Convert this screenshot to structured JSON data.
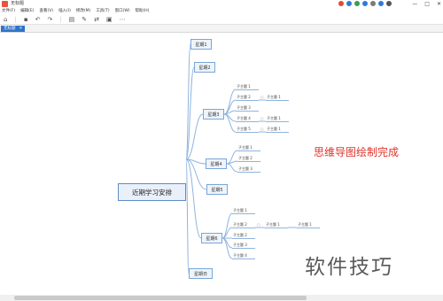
{
  "window": {
    "title": "无标题"
  },
  "tray_icons": [
    "#e34a2f",
    "#2f7cd6",
    "#3aa04d",
    "#2f7cd6",
    "#7a7a7a",
    "#2f7cd6",
    "#555555"
  ],
  "window_controls": [
    "—",
    "□",
    "✕"
  ],
  "menu": [
    "文件(F)",
    "编辑(E)",
    "查看(V)",
    "插入(I)",
    "修改(M)",
    "工具(T)",
    "窗口(W)",
    "帮助(H)"
  ],
  "toolbar_icons": [
    "home-icon",
    "save-icon",
    "undo-icon",
    "redo-icon",
    "folder-icon",
    "style-icon",
    "layout-icon",
    "image-icon",
    "more-icon"
  ],
  "toolbar_glyphs": [
    "⌂",
    "▪",
    "↶",
    "↷",
    "▤",
    "✎",
    "⇄",
    "▣",
    "⋯"
  ],
  "tab": {
    "label": "无标题",
    "close": "✕"
  },
  "mindmap": {
    "root": "近期学习安排",
    "topics": [
      {
        "label": "星期1"
      },
      {
        "label": "星期2"
      },
      {
        "label": "星期3",
        "subs": [
          {
            "label": "子主题 1"
          },
          {
            "label": "子主题 2",
            "child": "子主题 1"
          },
          {
            "label": "子主题 3"
          },
          {
            "label": "子主题 4",
            "child": "子主题 1"
          },
          {
            "label": "子主题 5",
            "child": "子主题 1"
          }
        ]
      },
      {
        "label": "星期4",
        "subs": [
          {
            "label": "子主题 1"
          },
          {
            "label": "子主题 2"
          },
          {
            "label": "子主题 3"
          }
        ]
      },
      {
        "label": "星期5"
      },
      {
        "label": "星期6",
        "subs": [
          {
            "label": "子主题 1"
          },
          {
            "label": "子主题 2",
            "child": "子主题 1",
            "grandchild": "子主题 1"
          },
          {
            "label": "子主题 2"
          },
          {
            "label": "子主题 3"
          },
          {
            "label": "子主题 4"
          }
        ]
      },
      {
        "label": "星期日"
      }
    ]
  },
  "annotation": "思维导图绘制完成",
  "watermark": "软件技巧",
  "colors": {
    "accent": "#2f73c9",
    "branch": "#8fb4de",
    "note": "#e0312a"
  }
}
